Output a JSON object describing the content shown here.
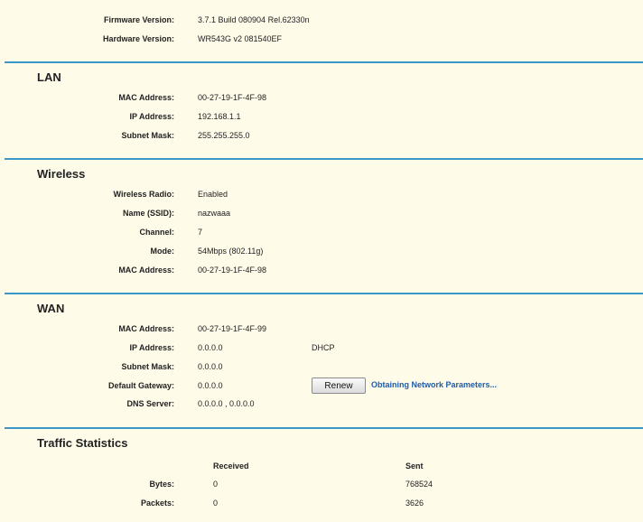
{
  "system": {
    "firmware_label": "Firmware Version:",
    "firmware_value": "3.7.1 Build 080904 Rel.62330n",
    "hardware_label": "Hardware Version:",
    "hardware_value": "WR543G v2 081540EF"
  },
  "lan": {
    "title": "LAN",
    "mac_label": "MAC Address:",
    "mac_value": "00-27-19-1F-4F-98",
    "ip_label": "IP Address:",
    "ip_value": "192.168.1.1",
    "mask_label": "Subnet Mask:",
    "mask_value": "255.255.255.0"
  },
  "wireless": {
    "title": "Wireless",
    "radio_label": "Wireless Radio:",
    "radio_value": "Enabled",
    "ssid_label": "Name (SSID):",
    "ssid_value": "nazwaaa",
    "channel_label": "Channel:",
    "channel_value": "7",
    "mode_label": "Mode:",
    "mode_value": "54Mbps (802.11g)",
    "mac_label": "MAC Address:",
    "mac_value": "00-27-19-1F-4F-98"
  },
  "wan": {
    "title": "WAN",
    "mac_label": "MAC Address:",
    "mac_value": "00-27-19-1F-4F-99",
    "ip_label": "IP Address:",
    "ip_value": "0.0.0.0",
    "connection_type": "DHCP",
    "mask_label": "Subnet Mask:",
    "mask_value": "0.0.0.0",
    "gateway_label": "Default Gateway:",
    "gateway_value": "0.0.0.0",
    "renew_label": "Renew",
    "renew_status": "Obtaining Network Parameters...",
    "dns_label": "DNS Server:",
    "dns_value": "0.0.0.0 , 0.0.0.0"
  },
  "traffic": {
    "title": "Traffic Statistics",
    "col_received": "Received",
    "col_sent": "Sent",
    "bytes_label": "Bytes:",
    "bytes_received": "0",
    "bytes_sent": "768524",
    "packets_label": "Packets:",
    "packets_received": "0",
    "packets_sent": "3626"
  },
  "colors": {
    "background": "#fffbe9",
    "divider": "#3b97c6",
    "status_link": "#1f5ca8"
  }
}
